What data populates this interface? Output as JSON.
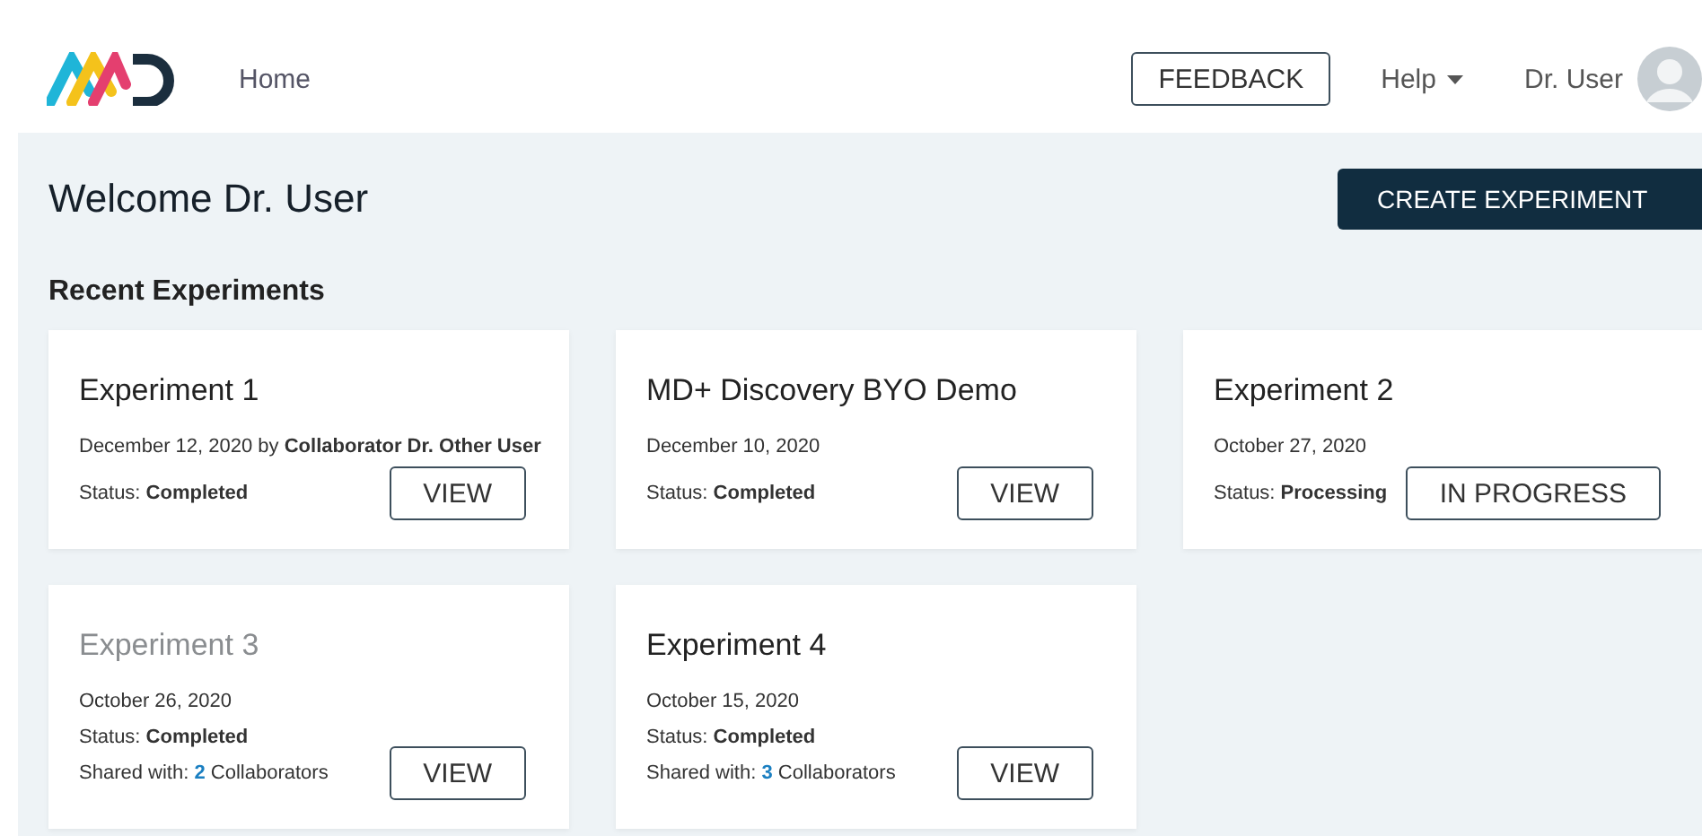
{
  "header": {
    "nav": [
      {
        "label": "Home",
        "selected": false
      }
    ],
    "feedback": "FEEDBACK",
    "help": "Help",
    "user": "Dr. User"
  },
  "welcome": "Welcome Dr. User",
  "create_button": "CREATE EXPERIMENT",
  "section_title": "Recent Experiments",
  "experiments": [
    {
      "title": "Experiment 1",
      "dimmed": false,
      "date": "December 12, 2020 by **Collaborator Dr. Other User**",
      "status": "Status: **Completed**",
      "action": "VIEW"
    },
    {
      "title": "MD+ Discovery BYO Demo",
      "dimmed": false,
      "date": "December 10, 2020",
      "status": "Status: **Completed**",
      "action": "VIEW"
    },
    {
      "title": "Experiment 2",
      "dimmed": false,
      "date": "October 27, 2020",
      "status": "Status: **Processing**",
      "action": "IN PROGRESS"
    },
    {
      "title": "Experiment 3",
      "dimmed": true,
      "date": "October 26, 2020",
      "status": "Status: **Completed**",
      "shared": {
        "label": "Shared with:",
        "count": "2",
        "suffix": "Collaborators"
      },
      "action": "VIEW"
    },
    {
      "title": "Experiment 4",
      "dimmed": false,
      "date": "October 15, 2020",
      "status": "Status: **Completed**",
      "shared": {
        "label": "Shared with:",
        "count": "3",
        "suffix": "Collaborators"
      },
      "action": "VIEW"
    }
  ]
}
